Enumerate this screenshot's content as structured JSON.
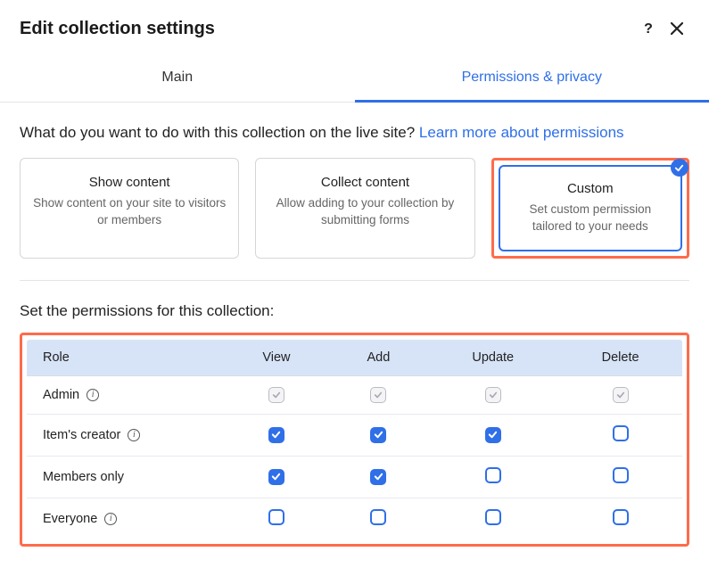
{
  "header": {
    "title": "Edit collection settings"
  },
  "tabs": {
    "main": "Main",
    "perms": "Permissions & privacy"
  },
  "question": {
    "text": "What do you want to do with this collection on the live site? ",
    "link": "Learn more about permissions"
  },
  "options": {
    "show": {
      "title": "Show content",
      "desc": "Show content on your site to visitors or members"
    },
    "collect": {
      "title": "Collect content",
      "desc": "Allow adding to your collection by submitting forms"
    },
    "custom": {
      "title": "Custom",
      "desc": "Set custom permission tailored to your needs"
    }
  },
  "permLabel": "Set the permissions for this collection:",
  "table": {
    "headers": {
      "role": "Role",
      "view": "View",
      "add": "Add",
      "update": "Update",
      "delete": "Delete"
    },
    "rows": [
      {
        "role": "Admin",
        "info": true,
        "view": "locked",
        "add": "locked",
        "update": "locked",
        "delete": "locked"
      },
      {
        "role": "Item's creator",
        "info": true,
        "view": "checked",
        "add": "checked",
        "update": "checked",
        "delete": "unchecked"
      },
      {
        "role": "Members only",
        "info": false,
        "view": "checked",
        "add": "checked",
        "update": "unchecked",
        "delete": "unchecked"
      },
      {
        "role": "Everyone",
        "info": true,
        "view": "unchecked",
        "add": "unchecked",
        "update": "unchecked",
        "delete": "unchecked"
      }
    ]
  }
}
